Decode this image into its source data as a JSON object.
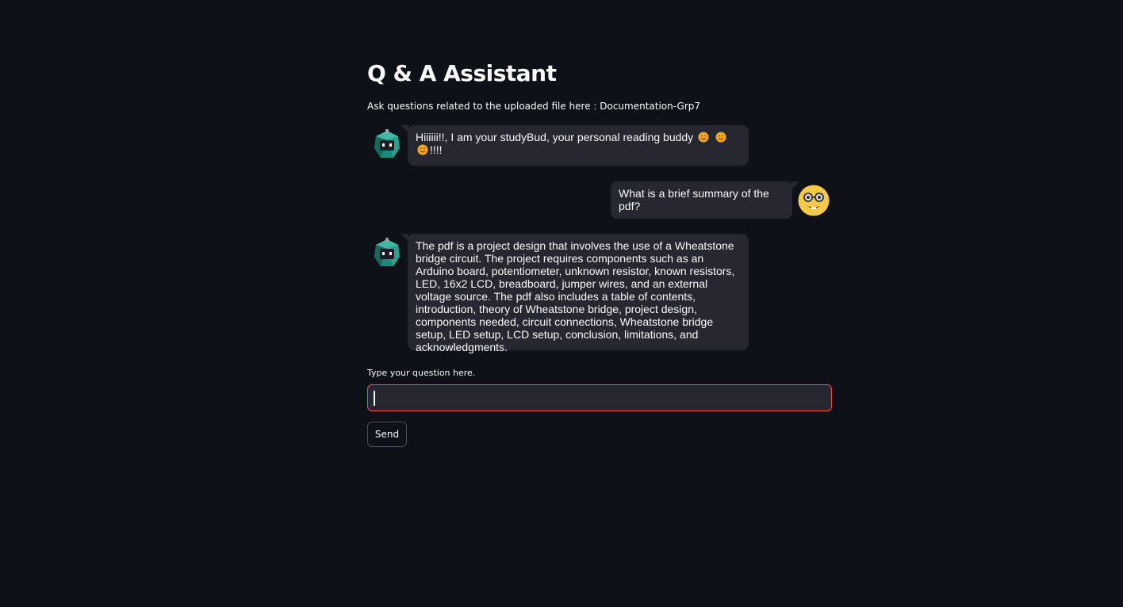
{
  "header": {
    "title": "Q & A Assistant",
    "subtitle": "Ask questions related to the uploaded file here : Documentation-Grp7"
  },
  "messages": [
    {
      "role": "assistant",
      "avatar_icon": "robot-avatar-icon",
      "text_before": "Hiiiiii!!, I am your studyBud, your personal reading buddy",
      "emoji_icon": "smiling-face-icon",
      "text_after": "!!!!"
    },
    {
      "role": "user",
      "avatar_icon": "nerd-face-avatar-icon",
      "text": "What is a brief summary of the pdf?"
    },
    {
      "role": "assistant",
      "avatar_icon": "robot-avatar-icon",
      "text": "The pdf is a project design that involves the use of a Wheatstone bridge circuit. The project requires components such as an Arduino board, potentiometer, unknown resistor, known resistors, LED, 16x2 LCD, breadboard, jumper wires, and an external voltage source. The pdf also includes a table of contents, introduction, theory of Wheatstone bridge, project design, components needed, circuit connections, Wheatstone bridge setup, LED setup, LCD setup, conclusion, limitations, and acknowledgments."
    }
  ],
  "input": {
    "label": "Type your question here.",
    "value": "",
    "placeholder": ""
  },
  "send_button": {
    "label": "Send"
  },
  "colors": {
    "background": "#0e1117",
    "bubble": "#262730",
    "input_focus_border": "#ff4b4b",
    "text": "#fafafa"
  }
}
